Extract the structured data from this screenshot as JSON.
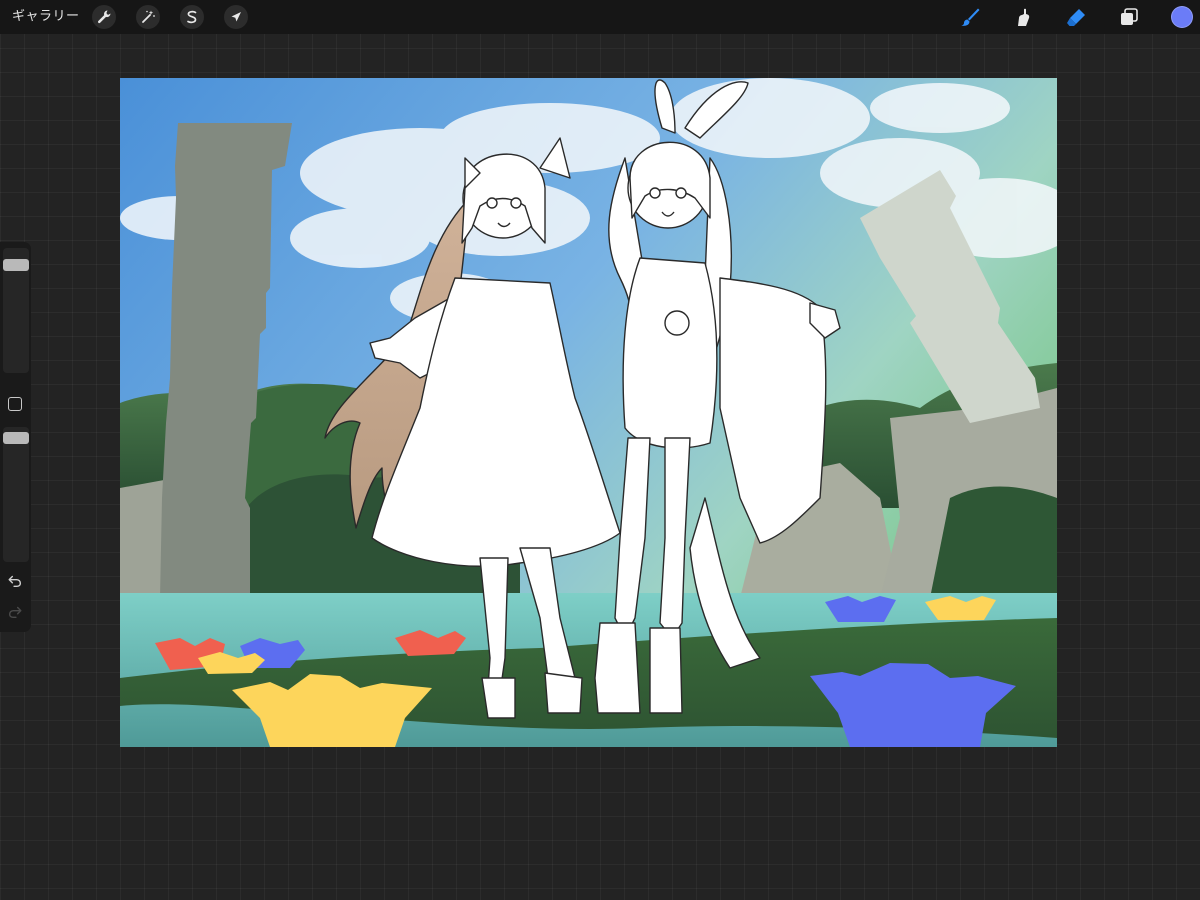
{
  "toolbar": {
    "gallery_label": "ギャラリー",
    "left_tools": [
      {
        "name": "actions",
        "icon": "wrench-icon"
      },
      {
        "name": "adjustments",
        "icon": "magic-wand-icon"
      },
      {
        "name": "selection",
        "icon": "selection-s-icon"
      },
      {
        "name": "transform",
        "icon": "arrow-cursor-icon"
      }
    ],
    "right_tools": [
      {
        "name": "brush",
        "icon": "brush-icon",
        "active": true
      },
      {
        "name": "smudge",
        "icon": "smudge-icon",
        "active": false
      },
      {
        "name": "eraser",
        "icon": "eraser-icon",
        "active": true
      },
      {
        "name": "layers",
        "icon": "layers-icon",
        "active": false
      }
    ],
    "current_color": "#6b7cf7",
    "active_tool_color": "#2f8cf6"
  },
  "sidebar": {
    "brush_size": 0.22,
    "brush_opacity": 0.95,
    "modify_icon": "square-icon",
    "undo_icon": "undo-icon",
    "redo_icon": "redo-icon",
    "redo_enabled": false
  },
  "canvas_art": {
    "description_colors": {
      "sky_top": "#4f97db",
      "sky_green": "#8fd0a4",
      "pillar_left": "#828a80",
      "pillar_right": "#cfd6cc",
      "rock": "#a7ab9f",
      "tree_dark": "#2f5a38",
      "water": "#6bbcb6",
      "grass": "#355e35",
      "flower_red": "#f0604f",
      "flower_yellow": "#fdd55b",
      "flower_blue": "#5c6ef0",
      "hair_brown": "#c5a88e"
    }
  }
}
